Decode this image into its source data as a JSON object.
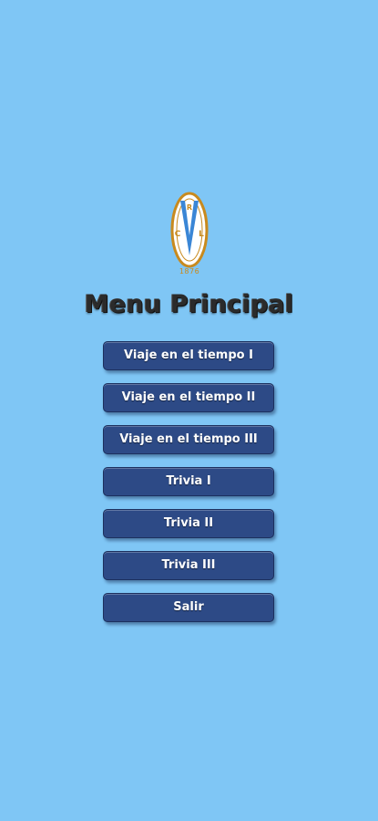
{
  "logo": {
    "icon": "school-crest-icon",
    "letters": [
      "R",
      "C",
      "L"
    ],
    "year": "1876",
    "accent_color": "#c88a1e"
  },
  "title": "Menu Principal",
  "menu": [
    {
      "label": "Viaje en el tiempo I"
    },
    {
      "label": "Viaje en el tiempo II"
    },
    {
      "label": "Viaje en el tiempo III"
    },
    {
      "label": "Trivia I"
    },
    {
      "label": "Trivia II"
    },
    {
      "label": "Trivia III"
    },
    {
      "label": "Salir"
    }
  ],
  "colors": {
    "background": "#7fc6f5",
    "button": "#2d4a86",
    "button_text": "#ffffff",
    "title_text": "#2b2b2b"
  }
}
